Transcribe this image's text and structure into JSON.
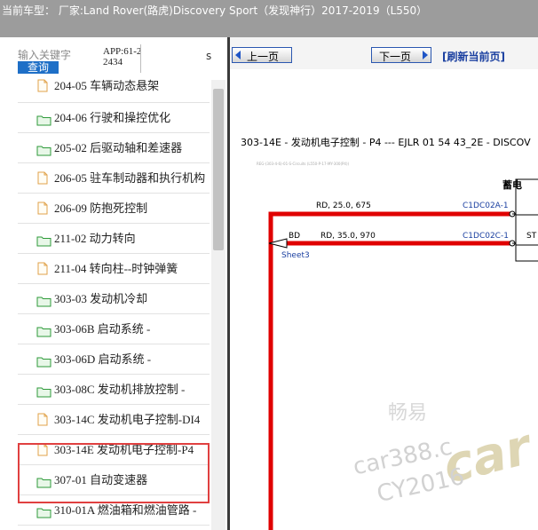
{
  "header": {
    "title": "当前车型：  厂家:Land Rover(路虎)Discovery Sport（发现神行）2017-2019（L550）"
  },
  "left": {
    "search": {
      "placeholder": "输入关键字",
      "button_label": "查询"
    },
    "app_id": "APP:61-22434",
    "side_char": "s",
    "tree": [
      {
        "label": "204-05 车辆动态悬架",
        "icon": "file-icon"
      },
      {
        "label": "204-06 行驶和操控优化",
        "icon": "folder-icon"
      },
      {
        "label": "205-02 后驱动轴和差速器",
        "icon": "folder-icon"
      },
      {
        "label": "206-05 驻车制动器和执行机构",
        "icon": "file-icon"
      },
      {
        "label": "206-09 防抱死控制",
        "icon": "file-icon"
      },
      {
        "label": "211-02 动力转向",
        "icon": "folder-icon"
      },
      {
        "label": "211-04 转向柱--时钟弹簧",
        "icon": "file-icon"
      },
      {
        "label": "303-03 发动机冷却",
        "icon": "folder-icon"
      },
      {
        "label": "303-06B 启动系统 -",
        "icon": "folder-icon"
      },
      {
        "label": "303-06D 启动系统 -",
        "icon": "folder-icon"
      },
      {
        "label": "303-08C 发动机排放控制 -",
        "icon": "folder-icon"
      },
      {
        "label": "303-14C 发动机电子控制-DI4",
        "icon": "file-icon"
      },
      {
        "label": "303-14E 发动机电子控制-P4",
        "icon": "file-icon"
      },
      {
        "label": "307-01 自动变速器",
        "icon": "folder-icon"
      },
      {
        "label": "310-01A 燃油箱和燃油管路 -",
        "icon": "folder-icon"
      }
    ]
  },
  "right": {
    "prev_label": "上一页",
    "next_label": "下一页",
    "refresh_label": "[刷新当前页]",
    "diagram_title": "303-14E - 发动机电子控制 - P4 --- EJLR 01 54 43_2E - DISCOV",
    "diagram_subtitle": "REG-(303-4-6)-01-S-Circuits (L550-P-17-MY-300(P4))",
    "box_label": "蓄电",
    "wires": [
      {
        "label": "RD, 25.0, 675",
        "connector": "C1DC02A-1"
      },
      {
        "label": "RD, 35.0, 970",
        "connector": "C1DC02C-1",
        "left_tag": "BD",
        "ref": "Sheet3",
        "pin_label": "ST"
      }
    ],
    "watermark": {
      "line1": "畅易",
      "line2": "car388.c",
      "line3": "CY2016",
      "logo": "car"
    }
  },
  "colors": {
    "topbar": "#9c9c9c",
    "wire": "#e00000",
    "accent": "#1e6fc7",
    "highlight": "#e04040"
  }
}
